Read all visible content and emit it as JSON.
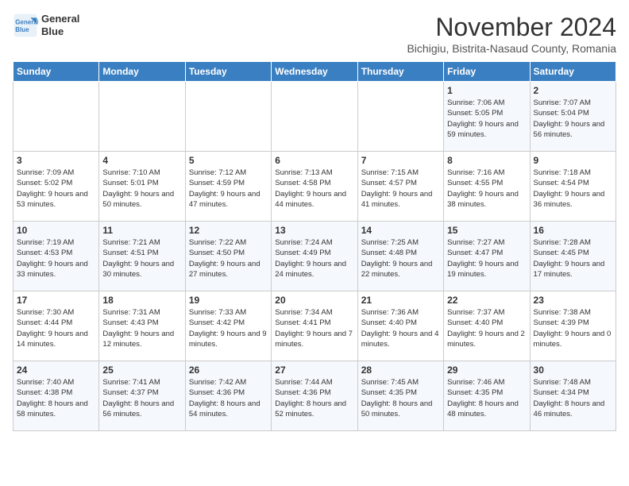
{
  "header": {
    "logo_line1": "General",
    "logo_line2": "Blue",
    "month": "November 2024",
    "location": "Bichigiu, Bistrita-Nasaud County, Romania"
  },
  "weekdays": [
    "Sunday",
    "Monday",
    "Tuesday",
    "Wednesday",
    "Thursday",
    "Friday",
    "Saturday"
  ],
  "weeks": [
    [
      {
        "day": "",
        "info": ""
      },
      {
        "day": "",
        "info": ""
      },
      {
        "day": "",
        "info": ""
      },
      {
        "day": "",
        "info": ""
      },
      {
        "day": "",
        "info": ""
      },
      {
        "day": "1",
        "info": "Sunrise: 7:06 AM\nSunset: 5:05 PM\nDaylight: 9 hours and 59 minutes."
      },
      {
        "day": "2",
        "info": "Sunrise: 7:07 AM\nSunset: 5:04 PM\nDaylight: 9 hours and 56 minutes."
      }
    ],
    [
      {
        "day": "3",
        "info": "Sunrise: 7:09 AM\nSunset: 5:02 PM\nDaylight: 9 hours and 53 minutes."
      },
      {
        "day": "4",
        "info": "Sunrise: 7:10 AM\nSunset: 5:01 PM\nDaylight: 9 hours and 50 minutes."
      },
      {
        "day": "5",
        "info": "Sunrise: 7:12 AM\nSunset: 4:59 PM\nDaylight: 9 hours and 47 minutes."
      },
      {
        "day": "6",
        "info": "Sunrise: 7:13 AM\nSunset: 4:58 PM\nDaylight: 9 hours and 44 minutes."
      },
      {
        "day": "7",
        "info": "Sunrise: 7:15 AM\nSunset: 4:57 PM\nDaylight: 9 hours and 41 minutes."
      },
      {
        "day": "8",
        "info": "Sunrise: 7:16 AM\nSunset: 4:55 PM\nDaylight: 9 hours and 38 minutes."
      },
      {
        "day": "9",
        "info": "Sunrise: 7:18 AM\nSunset: 4:54 PM\nDaylight: 9 hours and 36 minutes."
      }
    ],
    [
      {
        "day": "10",
        "info": "Sunrise: 7:19 AM\nSunset: 4:53 PM\nDaylight: 9 hours and 33 minutes."
      },
      {
        "day": "11",
        "info": "Sunrise: 7:21 AM\nSunset: 4:51 PM\nDaylight: 9 hours and 30 minutes."
      },
      {
        "day": "12",
        "info": "Sunrise: 7:22 AM\nSunset: 4:50 PM\nDaylight: 9 hours and 27 minutes."
      },
      {
        "day": "13",
        "info": "Sunrise: 7:24 AM\nSunset: 4:49 PM\nDaylight: 9 hours and 24 minutes."
      },
      {
        "day": "14",
        "info": "Sunrise: 7:25 AM\nSunset: 4:48 PM\nDaylight: 9 hours and 22 minutes."
      },
      {
        "day": "15",
        "info": "Sunrise: 7:27 AM\nSunset: 4:47 PM\nDaylight: 9 hours and 19 minutes."
      },
      {
        "day": "16",
        "info": "Sunrise: 7:28 AM\nSunset: 4:45 PM\nDaylight: 9 hours and 17 minutes."
      }
    ],
    [
      {
        "day": "17",
        "info": "Sunrise: 7:30 AM\nSunset: 4:44 PM\nDaylight: 9 hours and 14 minutes."
      },
      {
        "day": "18",
        "info": "Sunrise: 7:31 AM\nSunset: 4:43 PM\nDaylight: 9 hours and 12 minutes."
      },
      {
        "day": "19",
        "info": "Sunrise: 7:33 AM\nSunset: 4:42 PM\nDaylight: 9 hours and 9 minutes."
      },
      {
        "day": "20",
        "info": "Sunrise: 7:34 AM\nSunset: 4:41 PM\nDaylight: 9 hours and 7 minutes."
      },
      {
        "day": "21",
        "info": "Sunrise: 7:36 AM\nSunset: 4:40 PM\nDaylight: 9 hours and 4 minutes."
      },
      {
        "day": "22",
        "info": "Sunrise: 7:37 AM\nSunset: 4:40 PM\nDaylight: 9 hours and 2 minutes."
      },
      {
        "day": "23",
        "info": "Sunrise: 7:38 AM\nSunset: 4:39 PM\nDaylight: 9 hours and 0 minutes."
      }
    ],
    [
      {
        "day": "24",
        "info": "Sunrise: 7:40 AM\nSunset: 4:38 PM\nDaylight: 8 hours and 58 minutes."
      },
      {
        "day": "25",
        "info": "Sunrise: 7:41 AM\nSunset: 4:37 PM\nDaylight: 8 hours and 56 minutes."
      },
      {
        "day": "26",
        "info": "Sunrise: 7:42 AM\nSunset: 4:36 PM\nDaylight: 8 hours and 54 minutes."
      },
      {
        "day": "27",
        "info": "Sunrise: 7:44 AM\nSunset: 4:36 PM\nDaylight: 8 hours and 52 minutes."
      },
      {
        "day": "28",
        "info": "Sunrise: 7:45 AM\nSunset: 4:35 PM\nDaylight: 8 hours and 50 minutes."
      },
      {
        "day": "29",
        "info": "Sunrise: 7:46 AM\nSunset: 4:35 PM\nDaylight: 8 hours and 48 minutes."
      },
      {
        "day": "30",
        "info": "Sunrise: 7:48 AM\nSunset: 4:34 PM\nDaylight: 8 hours and 46 minutes."
      }
    ]
  ]
}
